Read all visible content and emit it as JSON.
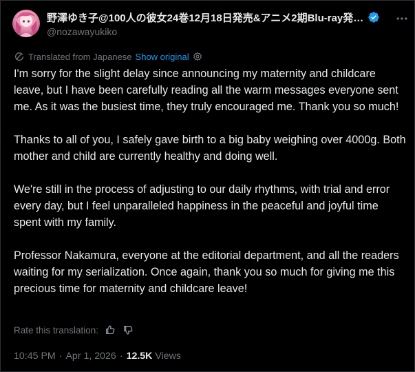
{
  "author": {
    "display_name": "野澤ゆき子@100人の彼女24巻12月18日発売&アニメ2期Blu-ray発…",
    "handle": "@nozawayukiko",
    "verified": true,
    "verified_color": "#1d9bf0"
  },
  "translation": {
    "notice": "Translated from Japanese",
    "show_original": "Show original",
    "icon": "translate-icon",
    "settings_icon": "gear-icon"
  },
  "post": {
    "paragraphs": [
      "I'm sorry for the slight delay since announcing my maternity and childcare leave, but I have been carefully reading all the warm messages everyone sent me. As it was the busiest time, they truly encouraged me. Thank you so much!",
      "Thanks to all of you, I safely gave birth to a big baby weighing over 4000g. Both mother and child are currently healthy and doing well.",
      "We're still in the process of adjusting to our daily rhythms, with trial and error every day, but I feel unparalleled happiness in the peaceful and joyful time spent with my family.",
      "Professor Nakamura, everyone at the editorial department, and all the readers waiting for my serialization. Once again, thank you so much for giving me this precious time for maternity and childcare leave!"
    ]
  },
  "rating": {
    "label": "Rate this translation:",
    "icons": [
      "thumbs-up-icon",
      "thumbs-down-icon"
    ]
  },
  "meta": {
    "time": "10:45 PM",
    "separator": "·",
    "date": "Apr 1, 2026",
    "views_count": "12.5K",
    "views_label": "Views"
  },
  "colors": {
    "background": "#000000",
    "text": "#e7e9ea",
    "secondary": "#71767b",
    "accent": "#1d9bf0"
  }
}
